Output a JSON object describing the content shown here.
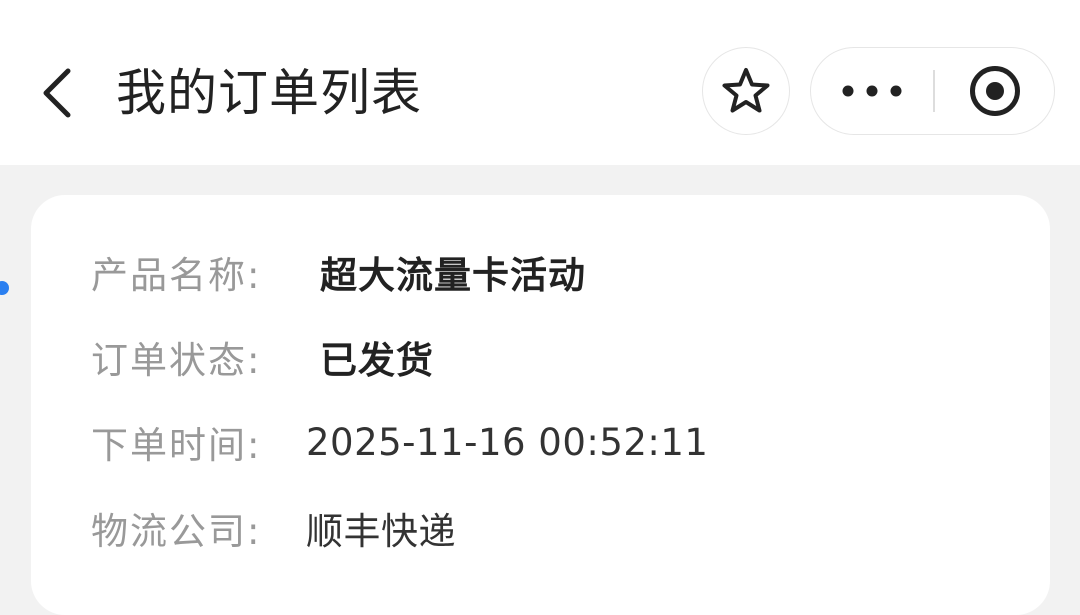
{
  "header": {
    "title": "我的订单列表",
    "back_icon": "chevron-left-icon",
    "favorite_icon": "star-outline-icon",
    "more_icon": "more-dots-icon",
    "close_icon": "target-circle-icon"
  },
  "order": {
    "fields": [
      {
        "label": "产品名称:",
        "value": "超大流量卡活动"
      },
      {
        "label": "订单状态:",
        "value": "已发货"
      },
      {
        "label": "下单时间:",
        "value": "2025-11-16 00:52:11"
      },
      {
        "label": "物流公司:",
        "value": "顺丰快递"
      }
    ]
  },
  "colors": {
    "background": "#f2f2f2",
    "card": "#ffffff",
    "label": "#999999",
    "value": "#333333",
    "indicator": "#2a7ff0"
  }
}
